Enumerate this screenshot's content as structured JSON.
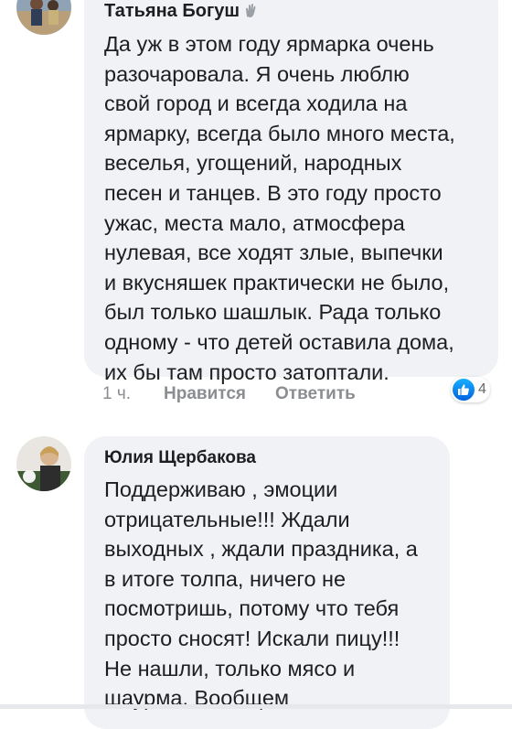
{
  "comments": [
    {
      "author": "Татьяна Богуш",
      "lines": [
        "Да уж в этом году ярмарка очень",
        "разочаровала. Я очень люблю",
        "свой город и всегда ходила на",
        "ярмарку, всегда было много места,",
        "веселья, угощений, народных",
        "песен и танцев. В это году просто",
        "ужас, места мало, атмосфера",
        "нулевая, все ходят злые, выпечки",
        "и вкусняшек практически не было,",
        "был только шашлык. Рада только",
        "одному - что детей оставила дома,",
        "их бы там просто затоптали."
      ],
      "time": "1 ч.",
      "like_label": "Нравится",
      "reply_label": "Ответить",
      "reaction_count": "4"
    },
    {
      "author": "Юлия Щербакова",
      "lines": [
        "Поддерживаю , эмоции",
        "отрицательные!!! Ждали",
        "выходных , ждали праздника, а",
        "в итоге толпа, ничего не",
        "посмотришь, потому что тебя",
        "просто сносят! Искали пицу!!!",
        "Не нашли, только мясо и",
        "шаурма. Вообщем"
      ]
    }
  ],
  "colors": {
    "bubble": "#f0f2f5",
    "like": "#1877f2",
    "meta": "#8a8d91"
  }
}
